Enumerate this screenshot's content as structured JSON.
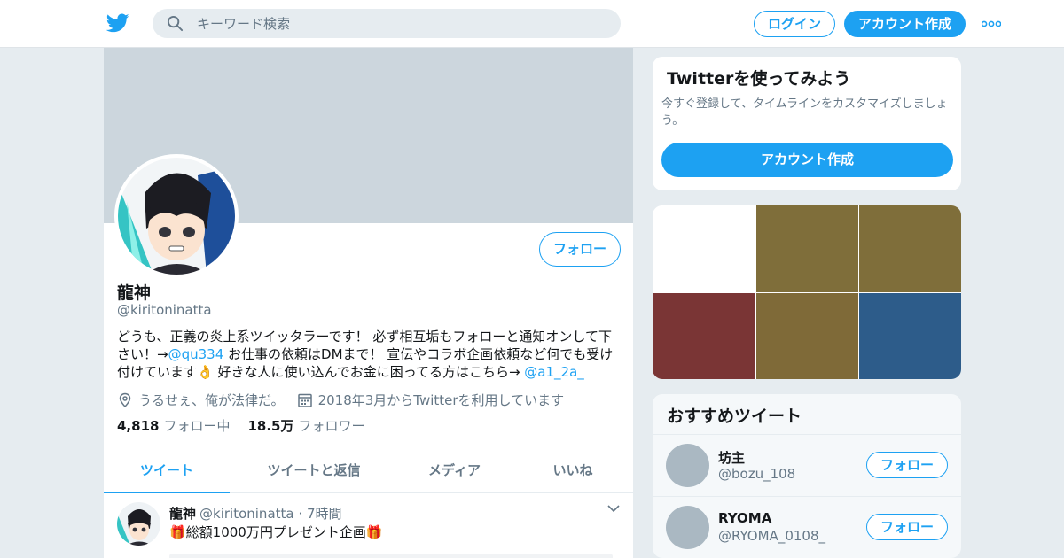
{
  "header": {
    "search_placeholder": "キーワード検索",
    "login_label": "ログイン",
    "signup_label": "アカウント作成"
  },
  "profile": {
    "name": "龍神",
    "handle": "@kiritoninatta",
    "follow_label": "フォロー",
    "bio": {
      "part1": "どうも、正義の炎上系ツイッタラーです！ 必ず相互垢もフォローと通知オンして下さい！→",
      "link1": "@qu334",
      "part2": " お仕事の依頼はDMまで！ 宣伝やコラボ企画依頼など何でも受け付けています👌 好きな人に使い込んでお金に困ってる方はこちら→ ",
      "link2": "@a1_2a_"
    },
    "location": "うるせぇ、俺が法律だ。",
    "joined": "2018年3月からTwitterを利用しています",
    "following_count": "4,818",
    "following_label": "フォロー中",
    "followers_count": "18.5万",
    "followers_label": "フォロワー"
  },
  "tabs": [
    {
      "label": "ツイート",
      "active": true
    },
    {
      "label": "ツイートと返信",
      "active": false
    },
    {
      "label": "メディア",
      "active": false
    },
    {
      "label": "いいね",
      "active": false
    }
  ],
  "tweet": {
    "name": "龍神",
    "handle": "@kiritoninatta",
    "separator": "·",
    "time": "7時間",
    "text": "🎁総額1000万円プレゼント企画🎁"
  },
  "try_card": {
    "title": "Twitterを使ってみよう",
    "text": "今すぐ登録して、タイムラインをカスタマイズしましょう。",
    "button_label": "アカウント作成"
  },
  "media_tiles": [
    "#ffffff",
    "#7f6e3a",
    "#7f6e3a",
    "#7a3535",
    "#7f6a38",
    "#2d5c8a"
  ],
  "recommended": {
    "title": "おすすめツイート",
    "follow_label": "フォロー",
    "accounts": [
      {
        "name": "坊主",
        "handle": "@bozu_108"
      },
      {
        "name": "RYOMA",
        "handle": "@RYOMA_0108_"
      }
    ]
  },
  "colors": {
    "accent": "#1da1f2",
    "banner": "#ccd6dd",
    "muted": "#657786"
  }
}
